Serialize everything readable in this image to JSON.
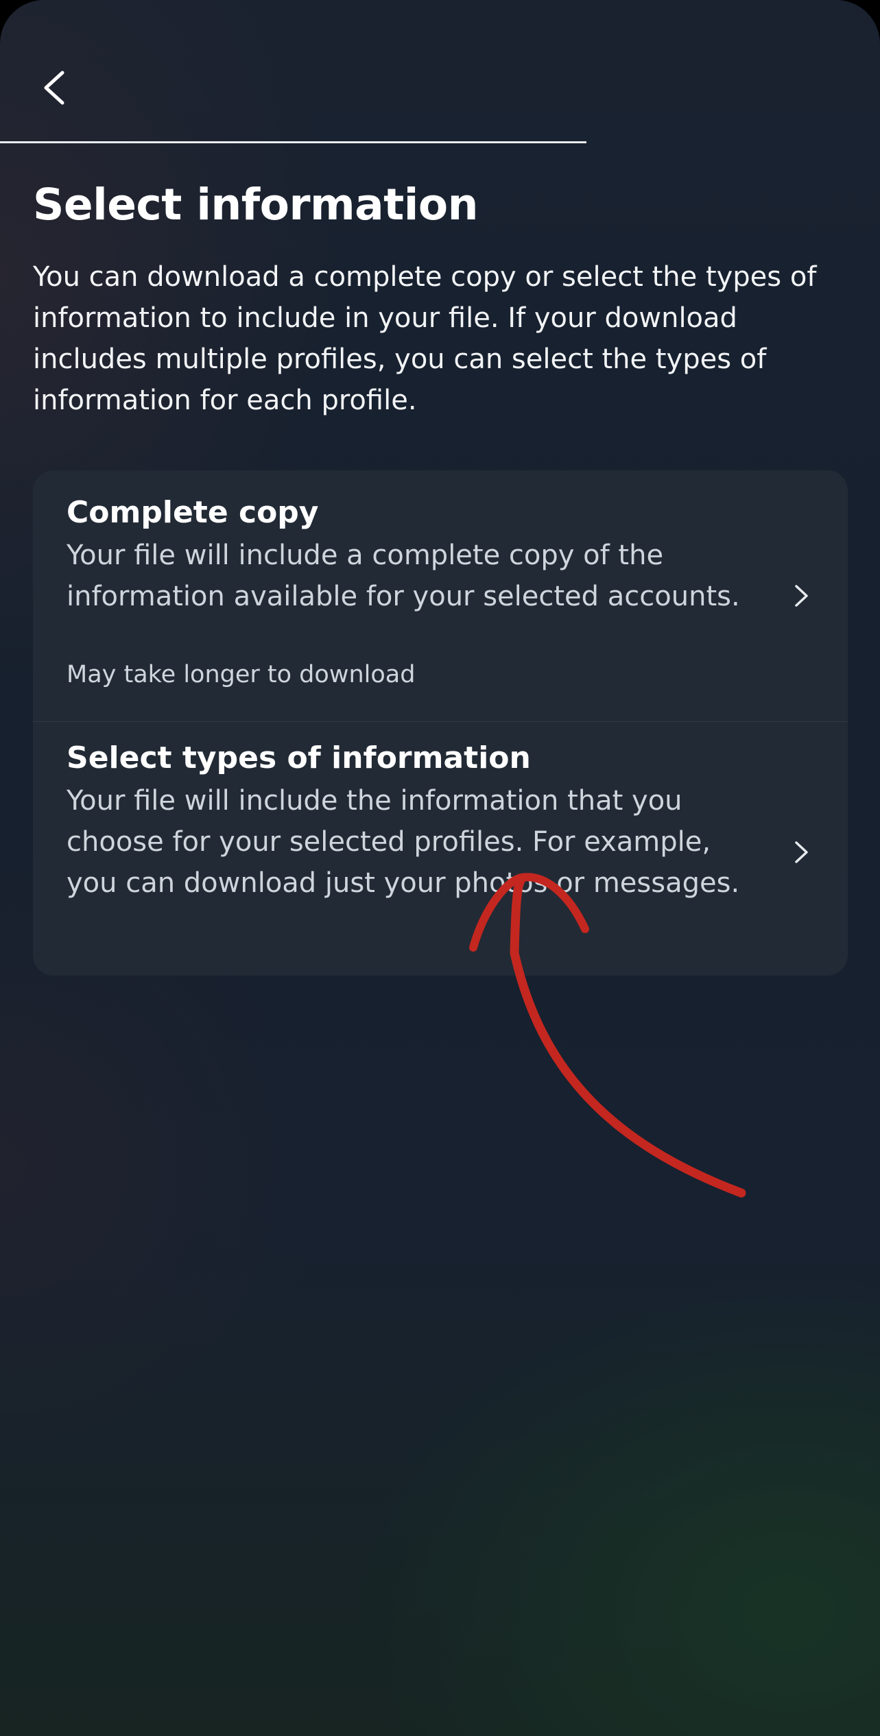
{
  "header": {
    "back_icon": "chevron-left-icon"
  },
  "page": {
    "title": "Select information",
    "description": "You can download a complete copy or select the types of information to include in your file. If your download includes multiple profiles, you can select the types of information for each profile."
  },
  "options": [
    {
      "title": "Complete copy",
      "description": "Your file will include a complete copy of the information available for your selected accounts.",
      "note": "May take longer to download",
      "icon": "chevron-right-icon"
    },
    {
      "title": "Select types of information",
      "description": "Your file will include the information that you choose for your selected profiles. For example, you can download just your photos or messages.",
      "icon": "chevron-right-icon"
    }
  ],
  "colors": {
    "annotation_arrow": "#c4271f",
    "card_background": "#222a35",
    "text_primary": "#ffffff",
    "text_secondary": "#cfd5dc"
  }
}
